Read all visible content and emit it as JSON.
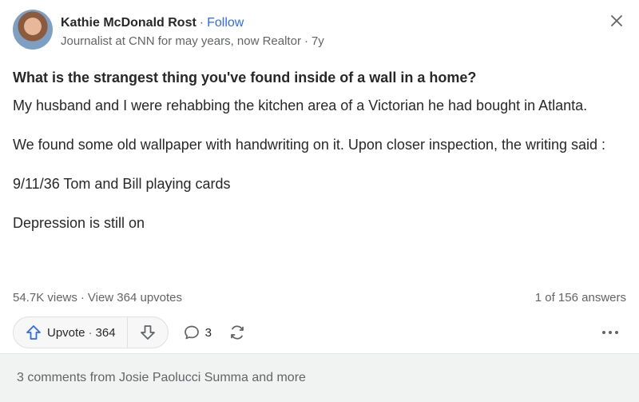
{
  "author": {
    "name": "Kathie McDonald Rost",
    "follow_label": "Follow",
    "credential": "Journalist at CNN for may years, now Realtor",
    "age": "7y"
  },
  "question": {
    "title": "What is the strangest thing you've found inside of a wall in a home?"
  },
  "answer": {
    "paragraphs": [
      "My husband and I were rehabbing the kitchen area of a Victorian he had bought in Atlanta.",
      "We found some old wallpaper with handwriting on it. Upon closer inspection, the writing said :",
      "9/11/36 Tom and Bill playing cards",
      "Depression is still on"
    ]
  },
  "stats": {
    "views": "54.7K views",
    "upvotes_link": "View 364 upvotes",
    "position": "1 of 156 answers"
  },
  "actions": {
    "upvote_label": "Upvote",
    "upvote_count": "364",
    "comment_count": "3"
  },
  "footer": {
    "comments_text": "3 comments from Josie Paolucci Summa and more"
  },
  "colors": {
    "link": "#2e69ff",
    "text": "#282829",
    "muted": "#636466",
    "footer_bg": "#f1f2f2",
    "upvote_icon": "#2e69ff"
  },
  "icons": [
    "close-icon",
    "upvote-arrow-icon",
    "downvote-arrow-icon",
    "comment-icon",
    "share-icon",
    "more-icon"
  ]
}
